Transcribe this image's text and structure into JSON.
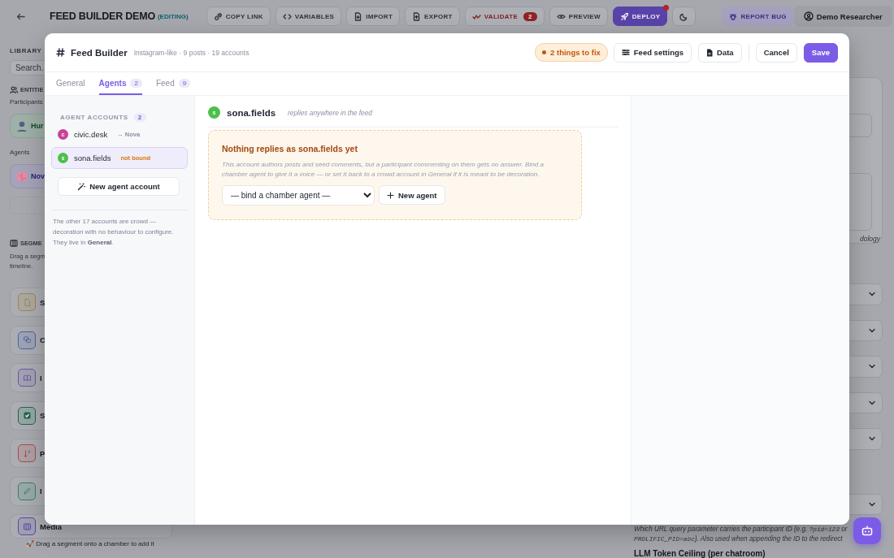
{
  "top_bar": {
    "title": "FEED BUILDER DEMO",
    "status": "(EDITING)",
    "actions": [
      {
        "kind": "link",
        "label": "COPY LINK",
        "alert": false
      },
      {
        "kind": "code",
        "label": "VARIABLES",
        "alert": false
      },
      {
        "kind": "import",
        "label": "IMPORT",
        "alert": false
      },
      {
        "kind": "export",
        "label": "EXPORT",
        "alert": false
      },
      {
        "kind": "validate",
        "label": "VALIDATE",
        "count": "2",
        "alert": false
      },
      {
        "kind": "preview",
        "label": "PREVIEW",
        "alert": false
      },
      {
        "kind": "deploy",
        "label": "DEPLOY",
        "alert": true
      },
      {
        "kind": "theme",
        "alert": false
      }
    ],
    "report_bug": "REPORT BUG",
    "user": "Demo Researcher"
  },
  "library": {
    "title": "LIBRARY",
    "search_placeholder": "Search.",
    "entities_heading": "ENTITIE",
    "participants_label": "Participants",
    "participant": "Hur",
    "agents_label": "Agents",
    "agent": "Nov",
    "segments_heading": "SEGME",
    "segments_hint": [
      "Drag a segm",
      "timeline."
    ],
    "segments": [
      {
        "kind": "seed",
        "label": "S",
        "color": "#a8843c"
      },
      {
        "kind": "chat",
        "label": "C",
        "color": "#4a64a8"
      },
      {
        "kind": "info",
        "label": "I",
        "color": "#6a55a8"
      },
      {
        "kind": "survey",
        "label": "S",
        "color": "#1d6b48"
      },
      {
        "kind": "poll",
        "label": "P",
        "color": "#b04844"
      },
      {
        "kind": "input",
        "label": "I",
        "color": "#2f8463"
      },
      {
        "kind": "media",
        "label": "Media",
        "color": "#5548a8"
      }
    ],
    "footer_hint": "🚀 Drag a segment onto a chamber to add it"
  },
  "settings": {
    "note_fragment": "dology",
    "help_lines": [
      [
        {
          "kind": "text",
          "text": "Which URL query parameter carries the participant ID (e.g. "
        },
        {
          "kind": "code",
          "text": "?pid=123"
        },
        {
          "kind": "text",
          "text": " or"
        }
      ],
      [
        {
          "kind": "code",
          "text": "PROLIFIC_PID=abc"
        },
        {
          "kind": "text",
          "text": "). Also used when appending the ID to the redirect"
        }
      ]
    ],
    "next_label": "LLM Token Ceiling (per chatroom)"
  },
  "modal": {
    "title": "Feed Builder",
    "subtitle": "Instagram-like · 9 posts · 19 accounts",
    "issues": "2 things to fix",
    "actions": [
      {
        "kind": "settings",
        "label": "Feed settings"
      },
      {
        "kind": "data",
        "label": "Data"
      },
      {
        "kind": "cancel",
        "label": "Cancel"
      },
      {
        "kind": "save",
        "label": "Save"
      }
    ],
    "tabs": [
      {
        "label": "General",
        "selected": false
      },
      {
        "label": "Agents",
        "count": "2",
        "selected": true
      },
      {
        "label": "Feed",
        "count": "9",
        "selected": false
      }
    ],
    "agent_accounts": {
      "heading": "AGENT ACCOUNTS",
      "count": "2",
      "items": [
        {
          "initial": "c",
          "name": "civic.desk",
          "binding": "→ Nova",
          "bound": true,
          "color": "#c8429b",
          "selected": false
        },
        {
          "initial": "s",
          "name": "sona.fields",
          "binding": "not bound",
          "bound": false,
          "color": "#4cc04a",
          "selected": true
        }
      ],
      "new_button": "New agent account",
      "note": "The other 17 accounts are crowd — decoration with no behaviour to configure. They live in **General**."
    },
    "detail": {
      "initial": "s",
      "name": "sona.fields",
      "color": "#4cc04a",
      "scope": "replies anywhere in the feed",
      "warning": {
        "title": "Nothing replies as sona.fields yet",
        "body": "This account authors posts and seed comments, but a participant commenting on them gets no answer. Bind a chamber agent to give it a voice — or set it back to a crowd account in General if it is meant to be decoration.",
        "select": "— bind a chamber agent —",
        "button": "New agent"
      }
    }
  }
}
